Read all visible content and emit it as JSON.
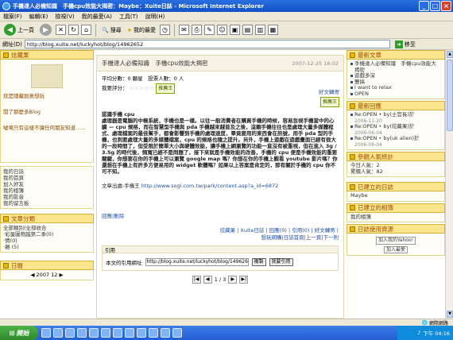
{
  "window": {
    "title": "手機達人必備知識　手機cpu效能大揭密：Maybe：Xuite日誌 - Microsoft Internet Explorer"
  },
  "menu": [
    "檔案(F)",
    "編輯(E)",
    "檢視(V)",
    "我的最愛(A)",
    "工具(T)",
    "說明(H)"
  ],
  "toolbar": {
    "back": "上一頁",
    "search": "搜尋",
    "favorites": "我的最愛"
  },
  "address": {
    "label": "網址(D)",
    "url": "http://blog.xuite.net/luckyhot/blog/14962652",
    "go": "移至",
    "links": "連結"
  },
  "left": {
    "header": "炫藏果",
    "lines": [
      "就是隱藏創意想玩",
      "閒了那麼多Blog",
      "噓噴只有這樣不讓任何朋友知道......"
    ],
    "nav": [
      "我的日誌",
      "我的首頁",
      "加入好友",
      "我的相簿",
      "我的影音",
      "我的留言板"
    ],
    "cat_header": "文章分類",
    "categories": [
      "全部類別(全部收合",
      "·彩蛋圖物越第二季(0)",
      "·情(0)",
      "·雜 (5)"
    ],
    "calendar_header": "日曆",
    "calendar_month": "2007 12"
  },
  "post": {
    "title": "手機達人必備知識　手機cpu效能大揭密",
    "date": "2007-12-25 16:02",
    "score": "平均分數：0 顆星　投票人數：0 人",
    "rate_label": "我要評分：",
    "stars": "☆☆☆☆☆",
    "recommend": "推薦王",
    "actions": [
      "好文轉寄",
      "推薦王"
    ],
    "body_title": "認識手機 cpu",
    "body": "處理器是電腦的中樞系統，手機也是一樣。以往一般消費者在購買手機的時候，容易忽視手機當中的心臟 — cpu 規格，而在智慧型手機與 pda 手機越來越普及之後，這顆手機往往也是處理大量多媒體程式、處理檔案的最佳幫手，都會影響到手機的處理速度，畢竟要用的東西會在訊號，用手 pda 型的手機，也到要處理大量的多媒體檔案，cpu 的規格也隨之提升。另外，手機上遊戲在遊戲畫面已經有很大的一段時間了，但受限於簡單大小與硬體效能，讓手機上網瀏覽的功能一直沒有被重視，但在進入 3g / 3.5g 的時代後，頻寬已經不是問題了，接下來就是手機效能的改善，手機的 cpu 便是手機效能的重要關鍵，你想要在你的手機上可以瀏覽 google map 嗎？你想在你的手機上觀看 youtube 影片嗎？你還想在手機上有許多方便易用的 widget 軟體嗎？如果以上答案是肯定的，那有關於手機的 cpu 你不可不知。",
    "source_label": "文章出處:手機王",
    "source_url": "http://www.sogi.com.tw/park/content.asp?a_id=6872",
    "comment_link": "回應|刪除",
    "footer_links": "炫藏果 | Xuite日誌 | 回應(0) | 引用(0) | 好文轉寄 |",
    "footer_links2": "想玩網購|日誌首頁|上一頁|下一則",
    "trackback_header": "引用",
    "trackback_label": "本文的引用網址",
    "trackback_url": "http://blog.xuite.net/luckyhot/blog/14962652/track",
    "copy_btn": "複製",
    "my_ref": "我要引用",
    "pager": "1 / 3"
  },
  "right": {
    "latest_header": "最新文章",
    "latest": [
      "手機達人必備知識　手機cpu效能大揭密",
      "遊戲多深",
      "雙搞",
      "I want to relax",
      "OPEN"
    ],
    "replies_header": "最新回應",
    "replies": [
      {
        "text": "Re:OPEN • by(士官長)於",
        "date": "2006-11-20"
      },
      {
        "text": "Re:OPEN • by(炫藏果)於",
        "date": "2006-06-04"
      },
      {
        "text": "Re:OPEN • by(uk alien)於",
        "date": "2006-06-04"
      }
    ],
    "stats_header": "參觀人氣統計",
    "today": "今日人氣：2",
    "total": "累積人氣：82",
    "blogs_header": "已建立的日誌",
    "blog_item": "Maybe",
    "albums_header": "已建立的相簿",
    "album_item": "我的相簿",
    "resources_header": "日誌使用資源",
    "add_yahoo": "加入我的Yahoo!",
    "add_fav": "加入最愛"
  },
  "status": {
    "left": "",
    "zone": "網際網路"
  },
  "taskbar": {
    "start": "開始",
    "time": "下午 04:16"
  }
}
